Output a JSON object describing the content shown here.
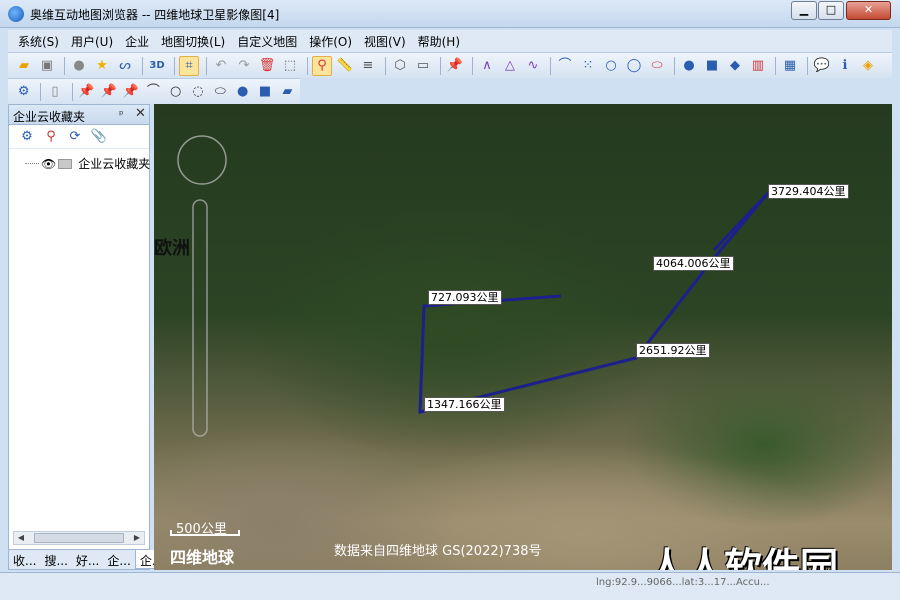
{
  "window": {
    "title": "奥维互动地图浏览器 -- 四维地球卫星影像图[4]",
    "min_label": "▁",
    "max_label": "□",
    "close_label": "✕"
  },
  "menu": [
    {
      "label": "系统(S)"
    },
    {
      "label": "用户(U)"
    },
    {
      "label": "企业"
    },
    {
      "label": "地图切换(L)"
    },
    {
      "label": "自定义地图"
    },
    {
      "label": "操作(O)"
    },
    {
      "label": "视图(V)"
    },
    {
      "label": "帮助(H)"
    }
  ],
  "panel": {
    "title": "企业云收藏夹",
    "pin": "ᵖ",
    "close": "✕",
    "tree_item": "企业云收藏夹",
    "tabs": [
      "收...",
      "搜...",
      "好...",
      "企...",
      "企..."
    ]
  },
  "map": {
    "region_label": "欧洲",
    "distances": [
      "3729.404公里",
      "4064.006公里",
      "727.093公里",
      "2651.92公里",
      "1347.166公里"
    ],
    "scale": "500公里",
    "logo": "四维地球",
    "credit": "数据来自四维地球 GS(2022)738号",
    "watermark": "人人软件园",
    "route_color": "#1c1f8c"
  },
  "status": {
    "coords": "lng:92.9...9066...lat:3...17...Accu..."
  }
}
